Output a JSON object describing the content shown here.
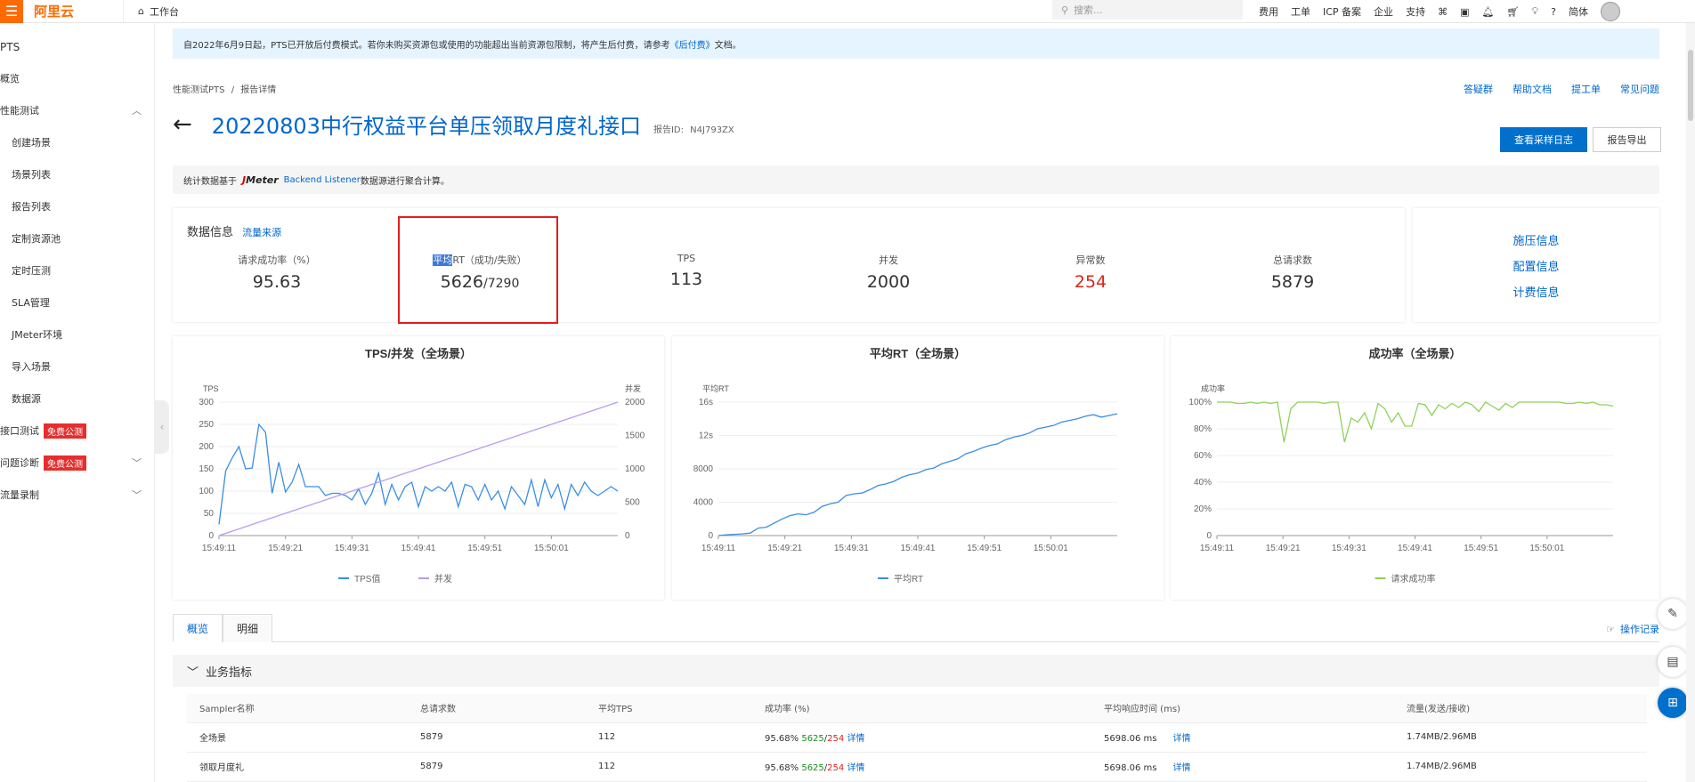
{
  "topbar": {
    "logo": "阿里云",
    "workbench": "工作台",
    "search_placeholder": "搜索...",
    "nav": [
      "费用",
      "工单",
      "ICP 备案",
      "企业",
      "支持"
    ],
    "lang": "简体"
  },
  "sidebar": {
    "title": "PTS",
    "items": [
      {
        "label": "概览"
      },
      {
        "label": "性能测试"
      },
      {
        "label": "创建场景"
      },
      {
        "label": "场景列表"
      },
      {
        "label": "报告列表"
      },
      {
        "label": "定制资源池"
      },
      {
        "label": "定时压测"
      },
      {
        "label": "SLA管理"
      },
      {
        "label": "JMeter环境"
      },
      {
        "label": "导入场景"
      },
      {
        "label": "数据源"
      },
      {
        "label": "接口测试",
        "badge": "免费公测"
      },
      {
        "label": "问题诊断",
        "badge": "免费公测"
      },
      {
        "label": "流量录制"
      }
    ]
  },
  "notice": {
    "text": "自2022年6月9日起，PTS已开放后付费模式。若你未购买资源包或使用的功能超出当前资源包限制，将产生后付费，请参考",
    "link": "《后付费》",
    "suffix": "文档。"
  },
  "breadcrumb": {
    "root": "性能测试PTS",
    "sep": "/",
    "current": "报告详情"
  },
  "help_links": [
    "答疑群",
    "帮助文档",
    "提工单",
    "常见问题"
  ],
  "title": "20220803中行权益平台单压领取月度礼接口",
  "report_id_label": "报告ID:",
  "report_id": "N4J793ZX",
  "buttons": {
    "logs": "查看采样日志",
    "export": "报告导出"
  },
  "source": {
    "prefix": "统计数据基于",
    "logo_j": "J",
    "logo_rest": "Meter",
    "link": "Backend Listener",
    "suffix": "数据源进行聚合计算。"
  },
  "stats": {
    "head": "数据信息",
    "head_link": "流量来源",
    "success_rate": {
      "label": "请求成功率（%）",
      "value": "95.63"
    },
    "avg_rt": {
      "label_hl": "平均",
      "label": "RT（成功/失败）",
      "value": "5626",
      "value2": "/7290"
    },
    "tps": {
      "label": "TPS",
      "value": "113"
    },
    "concurrency": {
      "label": "并发",
      "value": "2000"
    },
    "errors": {
      "label": "异常数",
      "value": "254"
    },
    "total": {
      "label": "总请求数",
      "value": "5879"
    }
  },
  "info_links": [
    "施压信息",
    "配置信息",
    "计费信息"
  ],
  "chart_data": [
    {
      "type": "line",
      "title": "TPS/并发（全场景）",
      "ylabel": "TPS",
      "y2label": "并发",
      "ylim": [
        0,
        300
      ],
      "y2lim": [
        0,
        2000
      ],
      "yticks": [
        "300",
        "250",
        "200",
        "150",
        "100",
        "50",
        "0"
      ],
      "y2ticks": [
        "2000",
        "1500",
        "1000",
        "500",
        "0"
      ],
      "xticks": [
        "15:49:11",
        "15:49:21",
        "15:49:31",
        "15:49:41",
        "15:49:51",
        "15:50:01"
      ],
      "series": [
        {
          "name": "TPS值",
          "color": "#3a8ee6",
          "values": [
            25,
            145,
            175,
            200,
            150,
            152,
            250,
            232,
            95,
            165,
            98,
            120,
            160,
            110,
            110,
            110,
            90,
            95,
            95,
            90,
            80,
            105,
            70,
            95,
            140,
            70,
            115,
            80,
            110,
            120,
            65,
            110,
            100,
            110,
            100,
            120,
            65,
            115,
            110,
            80,
            115,
            80,
            100,
            60,
            110,
            90,
            70,
            125,
            65,
            125,
            85,
            115,
            60,
            115,
            90,
            120,
            100,
            90,
            100,
            110,
            100
          ]
        },
        {
          "name": "并发",
          "color": "#b79cf0",
          "axis": "right",
          "values": [
            0,
            2000
          ]
        }
      ],
      "legend": "bottom"
    },
    {
      "type": "line",
      "title": "平均RT（全场景）",
      "ylabel": "平均RT",
      "ylim": [
        0,
        16000
      ],
      "yticks": [
        "16s",
        "12s",
        "8000",
        "4000",
        "0"
      ],
      "xticks": [
        "15:49:11",
        "15:49:21",
        "15:49:31",
        "15:49:41",
        "15:49:51",
        "15:50:01"
      ],
      "series": [
        {
          "name": "平均RT",
          "color": "#3a8ee6",
          "values": [
            0,
            100,
            150,
            200,
            300,
            900,
            1000,
            1500,
            2000,
            2400,
            2600,
            2500,
            2800,
            3500,
            3800,
            4000,
            4800,
            5000,
            5100,
            5500,
            6000,
            6200,
            6500,
            7000,
            7300,
            7500,
            7900,
            8100,
            8600,
            8900,
            9200,
            9800,
            10100,
            10500,
            10800,
            11000,
            11500,
            11800,
            12000,
            12300,
            12800,
            13000,
            13200,
            13600,
            13800,
            14000,
            14300,
            14500,
            14200,
            14400,
            14600
          ]
        }
      ],
      "legend": "bottom"
    },
    {
      "type": "line",
      "title": "成功率（全场景）",
      "ylabel": "成功率",
      "ylim": [
        0,
        100
      ],
      "yticks": [
        "100%",
        "80%",
        "60%",
        "40%",
        "20%",
        "0"
      ],
      "xticks": [
        "15:49:11",
        "15:49:21",
        "15:49:31",
        "15:49:41",
        "15:49:51",
        "15:50:01"
      ],
      "series": [
        {
          "name": "请求成功率",
          "color": "#8fd15a",
          "values": [
            100,
            100,
            100,
            99,
            99,
            100,
            99,
            100,
            99,
            100,
            70,
            95,
            100,
            100,
            100,
            100,
            99,
            100,
            100,
            70,
            88,
            85,
            92,
            80,
            99,
            95,
            85,
            92,
            82,
            82,
            99,
            98,
            90,
            98,
            95,
            99,
            96,
            100,
            98,
            93,
            100,
            97,
            94,
            99,
            96,
            100,
            100,
            100,
            100,
            100,
            100,
            100,
            99,
            99,
            100,
            99,
            100,
            98,
            98,
            97
          ]
        }
      ],
      "legend": "bottom"
    }
  ],
  "tabs": [
    "概览",
    "明细"
  ],
  "oplog": "操作记录",
  "section_title": "业务指标",
  "table": {
    "headers": [
      "Sampler名称",
      "总请求数",
      "平均TPS",
      "成功率 (%)",
      "平均响应时间 (ms)",
      "流量(发送/接收)"
    ],
    "rows": [
      {
        "name": "全场景",
        "total": "5879",
        "tps": "112",
        "rate": "95.68%",
        "ok": "5625",
        "fail": "254",
        "detail": "详情",
        "rt": "5698.06 ms",
        "rt_detail": "详情",
        "traffic": "1.74MB/2.96MB"
      },
      {
        "name": "领取月度礼",
        "total": "5879",
        "tps": "112",
        "rate": "95.68%",
        "ok": "5625",
        "fail": "254",
        "detail": "详情",
        "rt": "5698.06 ms",
        "rt_detail": "详情",
        "traffic": "1.74MB/2.96MB"
      }
    ]
  }
}
